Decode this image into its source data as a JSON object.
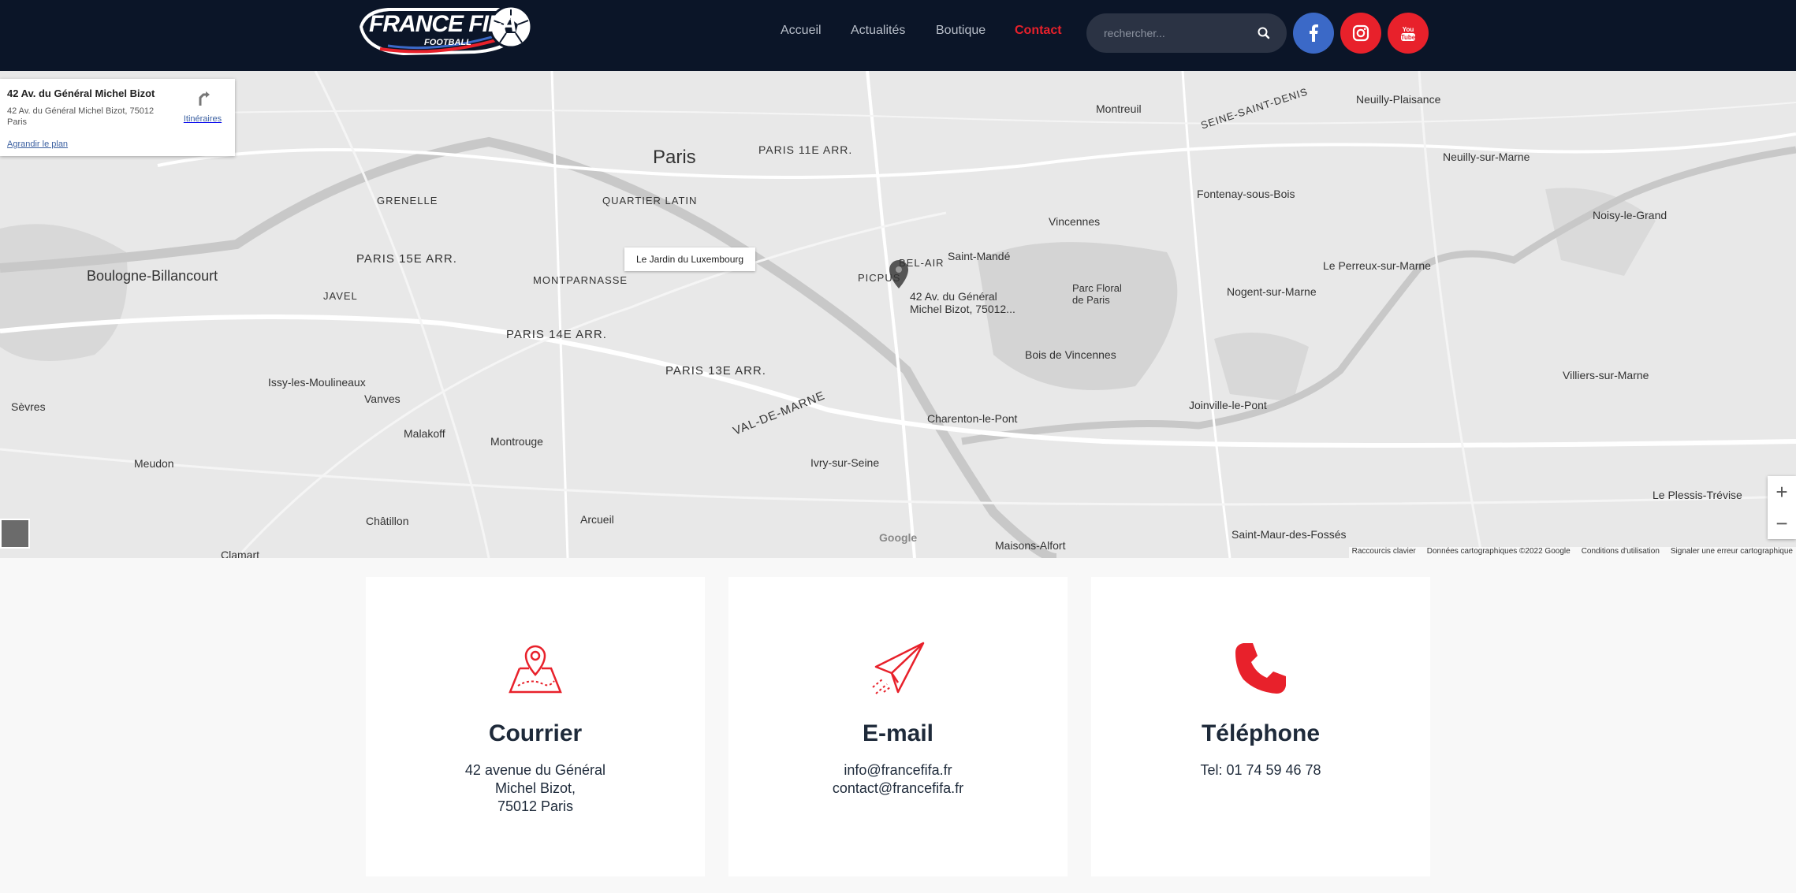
{
  "header": {
    "logo_text": "FRANCE FIFA",
    "logo_sub": "FOOTBALL",
    "nav": [
      {
        "label": "Accueil"
      },
      {
        "label": "Actualités"
      },
      {
        "label": "Boutique"
      },
      {
        "label": "Contact"
      }
    ],
    "search_placeholder": "rechercher...",
    "social": [
      "facebook-icon",
      "instagram-icon",
      "youtube-icon"
    ],
    "accent_color": "#e8212b"
  },
  "map": {
    "infobox": {
      "title": "42 Av. du Général Michel Bizot",
      "address": "42 Av. du Général Michel Bizot, 75012 Paris",
      "directions": "Itinéraires",
      "enlarge": "Agrandir le plan"
    },
    "tooltip": "Le Jardin du Luxembourg",
    "marker_label": "42 Av. du Général Michel Bizot, 75012...",
    "places": {
      "paris": "Paris",
      "boulogne": "Boulogne-Billancourt",
      "montreuil": "Montreuil",
      "vincennes": "Vincennes",
      "saint_mande": "Saint-Mandé",
      "ivry": "Ivry-sur-Seine",
      "charenton": "Charenton-le-Pont",
      "montrouge": "Montrouge",
      "vanves": "Vanves",
      "malakoff": "Malakoff",
      "meudon": "Meudon",
      "sevres": "Sèvres",
      "issy": "Issy-les-Moulineaux",
      "arcueil": "Arcueil",
      "chatillon": "Châtillon",
      "clamart": "Clamart",
      "nogent": "Nogent-sur-Marne",
      "joinville": "Joinville-le-Pont",
      "fontenay": "Fontenay-sous-Bois",
      "neuilly_plaisance": "Neuilly-Plaisance",
      "neuilly_marne": "Neuilly-sur-Marne",
      "noisy": "Noisy-le-Grand",
      "villiers": "Villiers-sur-Marne",
      "perreux": "Le Perreux-sur-Marne",
      "maisons_alfort": "Maisons-Alfort",
      "saint_maur": "Saint-Maur-des-Fossés",
      "plessis": "Le Plessis-Trévise",
      "paris15": "PARIS 15E ARR.",
      "paris14": "PARIS 14E ARR.",
      "paris13": "PARIS 13E ARR.",
      "paris11": "PARIS 11E ARR.",
      "val_de_marne": "VAL-DE-MARNE",
      "seine_saint_denis": "SEINE-SAINT-DENIS",
      "bois_vincennes": "Bois de Vincennes",
      "parc_floral": "Parc Floral de Paris",
      "montparnasse": "MONTPARNASSE",
      "picpus": "PICPUS",
      "bel_air": "BEL-AIR",
      "javel": "JAVEL",
      "grenelle": "GRENELLE",
      "quartier_latin": "QUARTIER LATIN"
    },
    "google": "Google",
    "attribution": [
      "Raccourcis clavier",
      "Données cartographiques ©2022 Google",
      "Conditions d'utilisation",
      "Signaler une erreur cartographique"
    ]
  },
  "cards": [
    {
      "title": "Courrier",
      "lines": [
        "42 avenue du Général",
        "Michel Bizot,",
        "75012 Paris"
      ],
      "icon": "map-pin-icon"
    },
    {
      "title": "E-mail",
      "lines": [
        "info@francefifa.fr",
        "contact@francefifa.fr"
      ],
      "icon": "paper-plane-icon"
    },
    {
      "title": "Téléphone",
      "lines": [
        "Tel: 01 74 59 46 78"
      ],
      "icon": "phone-icon"
    }
  ]
}
